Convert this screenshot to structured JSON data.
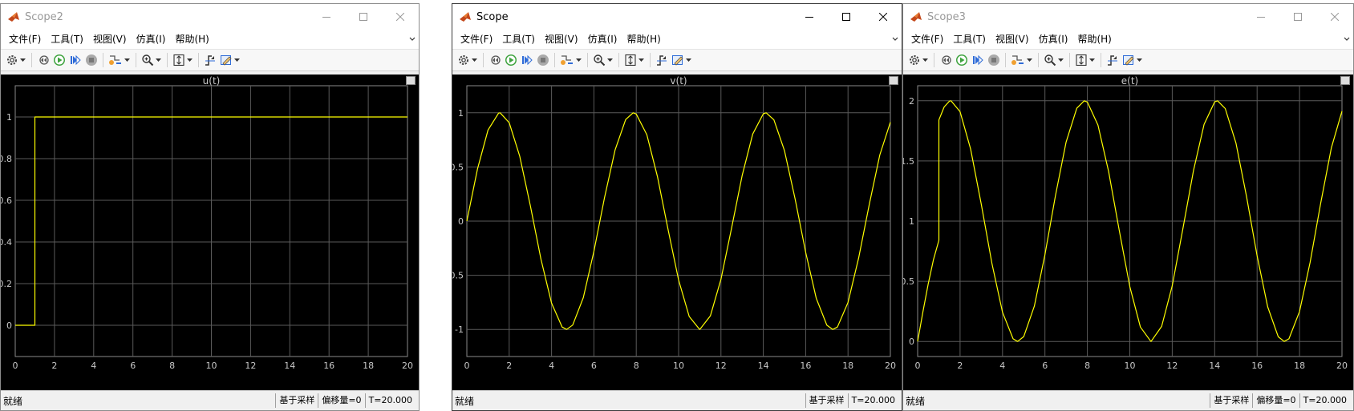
{
  "menu": [
    "文件(F)",
    "工具(T)",
    "视图(V)",
    "仿真(I)",
    "帮助(H)"
  ],
  "colors": {
    "trace": "#ffff00",
    "grid": "#5a5a5a",
    "axis_text": "#c8c8c8",
    "plot_bg": "#000000"
  },
  "windows": [
    {
      "title": "Scope2",
      "active": false,
      "status": {
        "text": "就绪",
        "mode": "基于采样",
        "offset": "偏移量=0",
        "time": "T=20.000"
      },
      "chart_data": {
        "type": "line",
        "title": "u(t)",
        "xlim": [
          0,
          20
        ],
        "ylim": [
          -0.15,
          1.15
        ],
        "xticks": [
          0,
          2,
          4,
          6,
          8,
          10,
          12,
          14,
          16,
          18,
          20
        ],
        "yticks": [
          0,
          0.2,
          0.4,
          0.6,
          0.8,
          1
        ],
        "ytick_labels": [
          "0",
          "0.2",
          "0.4",
          "0.6",
          "0.8",
          "1"
        ],
        "grid": true,
        "series": [
          {
            "x": [
              0,
              1,
              1,
              20
            ],
            "y": [
              0,
              0,
              1,
              1
            ]
          }
        ]
      }
    },
    {
      "title": "Scope",
      "active": true,
      "status": {
        "text": "就绪",
        "mode": "基于采样",
        "time": "T=20.000"
      },
      "chart_data": {
        "type": "line",
        "title": "v(t)",
        "xlim": [
          0,
          20
        ],
        "ylim": [
          -1.25,
          1.25
        ],
        "xticks": [
          0,
          2,
          4,
          6,
          8,
          10,
          12,
          14,
          16,
          18,
          20
        ],
        "yticks": [
          -1,
          -0.5,
          0,
          0.5,
          1
        ],
        "ytick_labels": [
          "-1",
          "-0.5",
          "0",
          "0.5",
          "1"
        ],
        "grid": true,
        "series": [
          {
            "x": [
              0,
              0.5,
              1,
              1.5,
              1.571,
              2,
              2.5,
              3,
              3.5,
              4,
              4.5,
              4.712,
              5,
              5.5,
              6,
              6.5,
              7,
              7.5,
              7.854,
              8,
              8.5,
              9,
              9.5,
              10,
              10.5,
              10.996,
              11,
              11.5,
              12,
              12.5,
              13,
              13.5,
              14,
              14.137,
              14.5,
              15,
              15.5,
              16,
              16.5,
              17,
              17.279,
              17.5,
              18,
              18.5,
              19,
              19.5,
              20
            ],
            "y": [
              0,
              0.479,
              0.841,
              0.997,
              1,
              0.909,
              0.598,
              0.141,
              -0.351,
              -0.757,
              -0.978,
              -1,
              -0.959,
              -0.706,
              -0.279,
              0.215,
              0.657,
              0.938,
              1,
              0.989,
              0.798,
              0.412,
              -0.075,
              -0.544,
              -0.88,
              -1,
              -1,
              -0.875,
              -0.537,
              -0.066,
              0.42,
              0.804,
              0.991,
              1,
              0.935,
              0.65,
              0.206,
              -0.288,
              -0.712,
              -0.961,
              -1,
              -0.978,
              -0.751,
              -0.342,
              0.15,
              0.61,
              0.913
            ]
          }
        ]
      }
    },
    {
      "title": "Scope3",
      "active": false,
      "status": {
        "text": "就绪",
        "mode": "基于采样",
        "offset": "偏移量=0",
        "time": "T=20.000"
      },
      "chart_data": {
        "type": "line",
        "title": "e(t)",
        "xlim": [
          0,
          20
        ],
        "ylim": [
          -0.125,
          2.125
        ],
        "xticks": [
          0,
          2,
          4,
          6,
          8,
          10,
          12,
          14,
          16,
          18,
          20
        ],
        "yticks": [
          0,
          0.5,
          1,
          1.5,
          2
        ],
        "ytick_labels": [
          "0",
          "0.5",
          "1",
          "1.5",
          "2"
        ],
        "grid": true,
        "series": [
          {
            "x": [
              0,
              0.25,
              0.5,
              0.75,
              1,
              1,
              1.25,
              1.5,
              1.571,
              2,
              2.5,
              3,
              3.5,
              4,
              4.5,
              4.712,
              5,
              5.5,
              6,
              6.5,
              7,
              7.5,
              7.854,
              8,
              8.5,
              9,
              9.5,
              10,
              10.5,
              10.996,
              11,
              11.5,
              12,
              12.5,
              13,
              13.5,
              14,
              14.137,
              14.5,
              15,
              15.5,
              16,
              16.5,
              17,
              17.279,
              17.5,
              18,
              18.5,
              19,
              19.5,
              20
            ],
            "y": [
              0,
              0.247,
              0.479,
              0.682,
              0.841,
              1.841,
              1.949,
              1.997,
              2,
              1.909,
              1.598,
              1.141,
              0.649,
              0.243,
              0.022,
              0,
              0.041,
              0.294,
              0.721,
              1.215,
              1.657,
              1.938,
              2,
              1.989,
              1.798,
              1.412,
              0.925,
              0.456,
              0.12,
              0,
              0,
              0.125,
              0.463,
              0.934,
              1.42,
              1.804,
              1.991,
              2,
              1.935,
              1.65,
              1.206,
              0.712,
              0.288,
              0.039,
              0,
              0.022,
              0.249,
              0.658,
              1.15,
              1.61,
              1.913
            ]
          }
        ]
      }
    }
  ]
}
